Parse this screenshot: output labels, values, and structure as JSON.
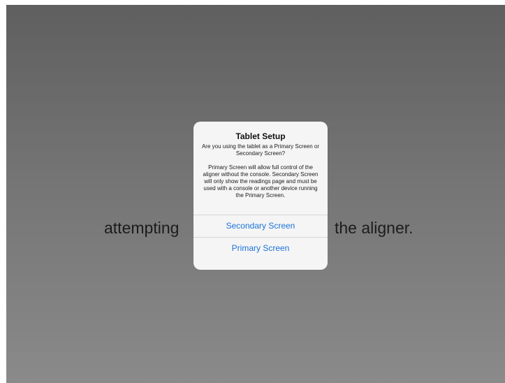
{
  "background": {
    "left_text": "attempting",
    "right_text": "the aligner."
  },
  "alert": {
    "title": "Tablet Setup",
    "message_1": "Are you using the tablet as a Primary Screen  or Secondary Screen?",
    "message_2": "Primary Screen will allow full control of the aligner without the console. Secondary Screen will only show the readings page and must be used with a console or another device running the Primary Screen.",
    "buttons": [
      {
        "label": "Secondary Screen"
      },
      {
        "label": "Primary Screen"
      }
    ]
  },
  "colors": {
    "accent": "#1a73d9",
    "alert_bg": "#f5f5f5"
  }
}
